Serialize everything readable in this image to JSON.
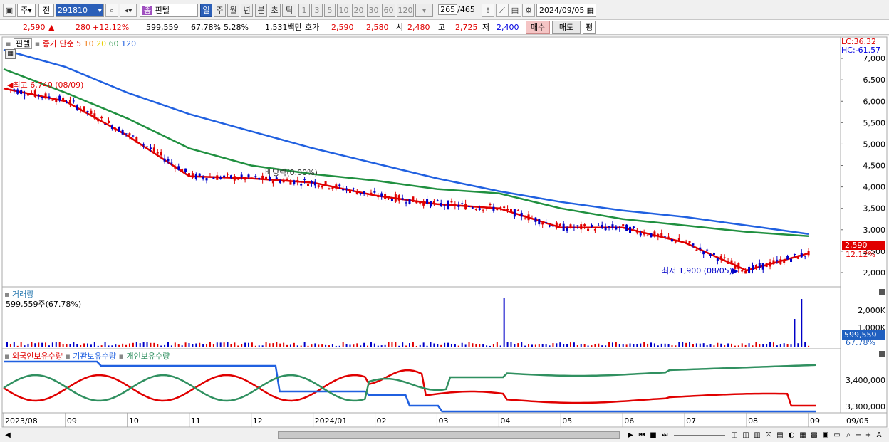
{
  "toolbar": {
    "market_label": "주",
    "prev_label": "전",
    "stock_code": "291810",
    "stock_name": "핀텔",
    "stock_badge": "종",
    "periods": [
      "일",
      "주",
      "월",
      "년",
      "분",
      "초",
      "틱"
    ],
    "period_selected": "일",
    "intervals": [
      "1",
      "3",
      "5",
      "10",
      "20",
      "30",
      "60",
      "120"
    ],
    "count": "265",
    "total": "/465",
    "date": "2024/09/05"
  },
  "quote": {
    "price": "2,590",
    "change": "280",
    "change_pct": "+12.12%",
    "volume": "599,559",
    "volume_ratio": "67.78%",
    "turnover": "5.28%",
    "amount": "1,531백만",
    "ask_label": "호가",
    "ask": "2,590",
    "bid": "2,580",
    "open_label": "시",
    "open": "2,480",
    "high_label": "고",
    "high": "2,725",
    "low_label": "저",
    "low": "2,400",
    "buy": "매수",
    "sell": "매도",
    "avg": "평"
  },
  "chart": {
    "legend_name": "핀텔",
    "legend_desc": "종가 단순",
    "ma_periods": [
      "5",
      "10",
      "20",
      "60",
      "120"
    ],
    "lc": "LC:36.32",
    "hc": "HC:-61.57",
    "high_annot": "최고 6,740 (08/09)",
    "low_annot": "최저 1,900 (08/05)",
    "dividend_annot": "배당락(0.00%)",
    "price_ticks": [
      "7,000",
      "6,500",
      "6,000",
      "5,500",
      "5,000",
      "4,500",
      "4,000",
      "3,500",
      "3,000",
      "2,500",
      "2,000"
    ],
    "last_price": "2,590",
    "last_pct": "12.12%",
    "volume_title": "거래량",
    "volume_value": "599,559주(67.78%)",
    "volume_ticks": [
      "2,000K",
      "1,000K"
    ],
    "volume_last": "599,559",
    "volume_last_pct": "67.78%",
    "holders_titles": [
      "외국인보유수량",
      "기관보유수량",
      "개인보유수량"
    ],
    "holders_ticks": [
      "3,400,000",
      "3,300,000"
    ],
    "x_labels": [
      "2023/08",
      "09",
      "10",
      "11",
      "12",
      "2024/01",
      "02",
      "03",
      "04",
      "05",
      "06",
      "07",
      "08",
      "09"
    ],
    "x_right_label": "09/05",
    "colors": {
      "up": "#e00000",
      "down": "#0000c8",
      "ma5": "#e00000",
      "ma10": "#f08020",
      "ma20": "#f0e000",
      "ma60": "#209040",
      "ma120": "#2060e0",
      "foreign": "#e00000",
      "inst": "#2060e0",
      "indiv": "#309060"
    }
  },
  "chart_data": {
    "type": "line",
    "title": "핀텔",
    "x": [
      "2023/08",
      "09",
      "10",
      "11",
      "12",
      "2024/01",
      "02",
      "03",
      "04",
      "05",
      "06",
      "07",
      "08",
      "09"
    ],
    "series": [
      {
        "name": "120",
        "values": [
          7200,
          6800,
          6200,
          5700,
          5300,
          4900,
          4550,
          4200,
          3900,
          3650,
          3450,
          3300,
          3100,
          2900
        ]
      },
      {
        "name": "60",
        "values": [
          6750,
          6200,
          5600,
          4900,
          4500,
          4300,
          4150,
          3950,
          3850,
          3500,
          3250,
          3100,
          2950,
          2850
        ]
      },
      {
        "name": "5",
        "values": [
          6300,
          6000,
          5200,
          4250,
          4200,
          4100,
          3800,
          3600,
          3500,
          3050,
          3050,
          2700,
          2050,
          2450
        ]
      }
    ],
    "ylim": [
      1800,
      7400
    ],
    "ylabel": ""
  }
}
